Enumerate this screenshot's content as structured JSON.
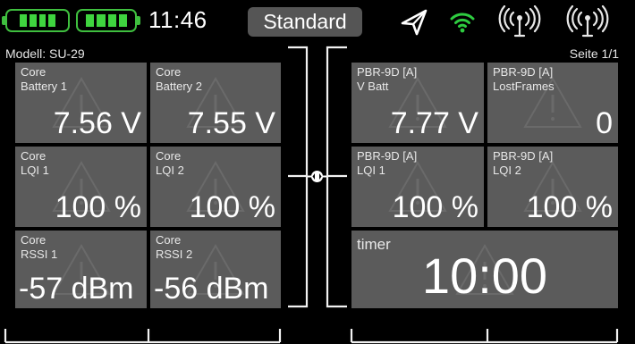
{
  "status_bar": {
    "time": "11:46",
    "mode_label": "Standard",
    "battery_color": "#3fd43f",
    "wifi_color": "#2ecc40",
    "icons": [
      "battery-icon",
      "battery-icon",
      "navigation-arrow-icon",
      "wifi-icon",
      "antenna-icon",
      "antenna-icon"
    ]
  },
  "header": {
    "model": "Modell: SU-29",
    "page": "Seite 1/1"
  },
  "left_tiles": [
    {
      "source": "Core",
      "label": "Battery 1",
      "value": "7.56 V"
    },
    {
      "source": "Core",
      "label": "Battery 2",
      "value": "7.55 V"
    },
    {
      "source": "Core",
      "label": "LQI 1",
      "value": "100 %"
    },
    {
      "source": "Core",
      "label": "LQI 2",
      "value": "100 %"
    },
    {
      "source": "Core",
      "label": "RSSI 1",
      "value": "-57 dBm"
    },
    {
      "source": "Core",
      "label": "RSSI 2",
      "value": "-56 dBm"
    }
  ],
  "right_tiles": [
    {
      "source": "PBR-9D [A]",
      "label": "V Batt",
      "value": "7.77 V"
    },
    {
      "source": "PBR-9D [A]",
      "label": "LostFrames",
      "value": "0"
    },
    {
      "source": "PBR-9D [A]",
      "label": "LQI 1",
      "value": "100 %"
    },
    {
      "source": "PBR-9D [A]",
      "label": "LQI 2",
      "value": "100 %"
    }
  ],
  "timer_tile": {
    "label": "timer",
    "value": "10:00"
  },
  "colors": {
    "tile": "#5b5b5b",
    "background": "#000000",
    "frame": "#ffffff"
  }
}
